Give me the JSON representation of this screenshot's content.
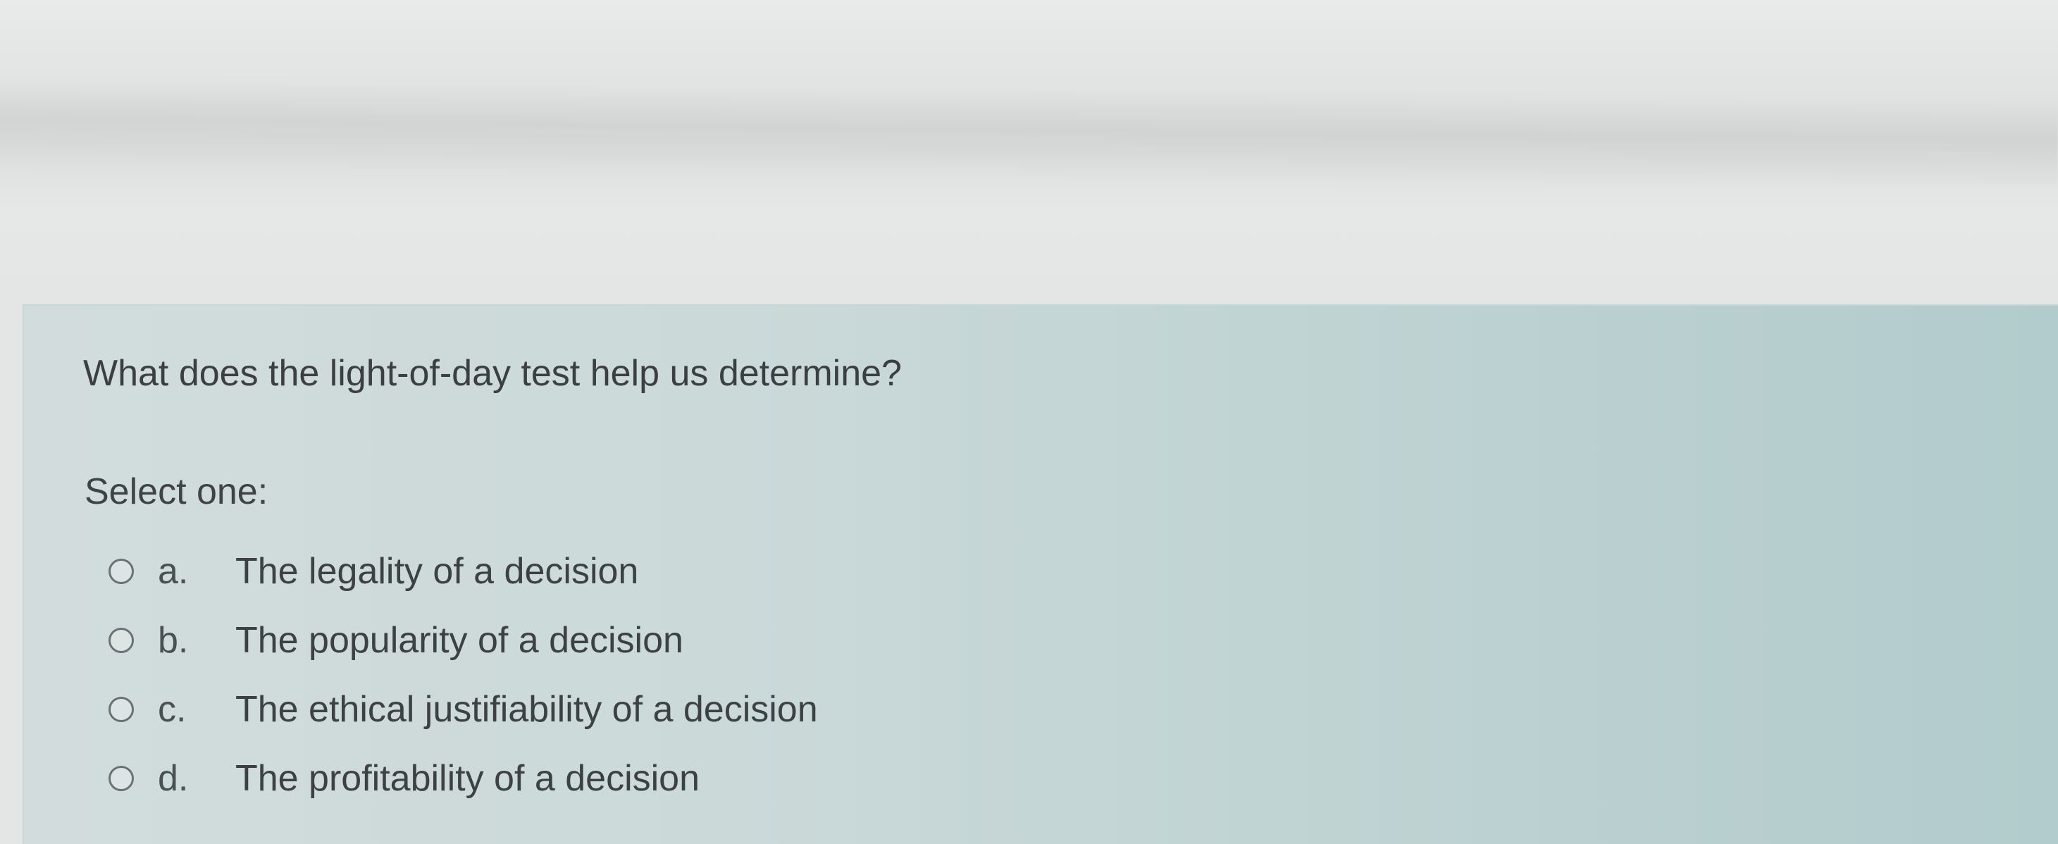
{
  "question": {
    "text": "What does the light-of-day test help us determine?",
    "prompt": "Select one:",
    "options": [
      {
        "letter": "a.",
        "text": "The legality of a decision",
        "selected": false
      },
      {
        "letter": "b.",
        "text": "The popularity of a decision",
        "selected": false
      },
      {
        "letter": "c.",
        "text": "The ethical justifiability of a decision",
        "selected": false
      },
      {
        "letter": "d.",
        "text": "The profitability of a decision",
        "selected": false
      }
    ]
  }
}
